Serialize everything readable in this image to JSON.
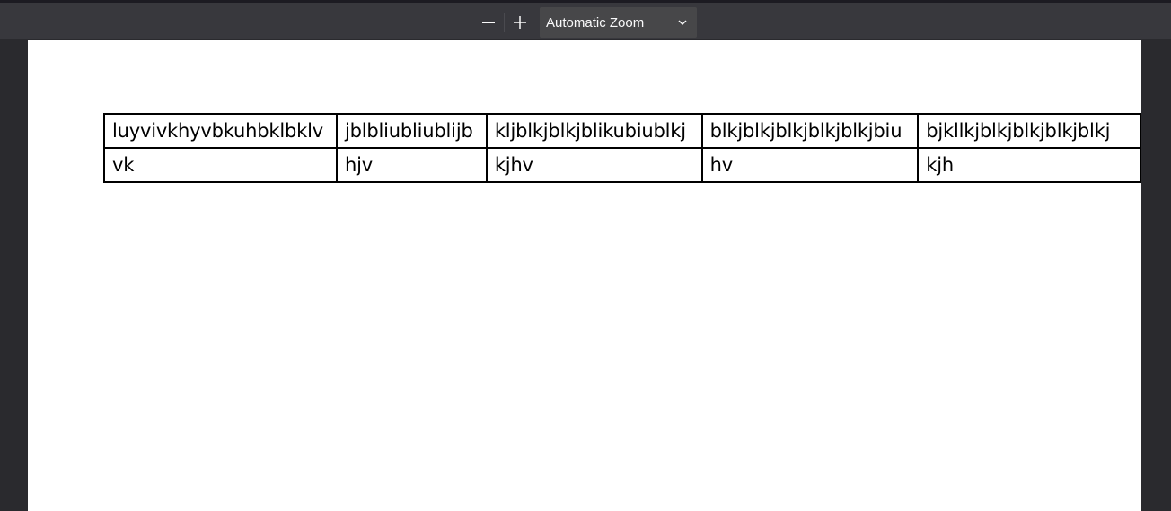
{
  "toolbar": {
    "zoom_out_icon": "minus-icon",
    "zoom_in_icon": "plus-icon",
    "zoom_select": {
      "selected": "Automatic Zoom",
      "icon": "chevron-down-icon"
    }
  },
  "document": {
    "table": {
      "rows": [
        [
          "luyvivkhyvbkuhbklbklv",
          "jblbliubliublijb",
          "kljblkjblkjblikubiublkj",
          "blkjblkjblkjblkjblkjbiu",
          "bjkllkjblkjblkjblkjblkj"
        ],
        [
          "vk",
          "hjv",
          "kjhv",
          "hv",
          "kjh"
        ]
      ]
    }
  },
  "colors": {
    "toolbar_bg": "#38383d",
    "viewer_bg": "#2a2a2e",
    "page_bg": "#ffffff"
  }
}
